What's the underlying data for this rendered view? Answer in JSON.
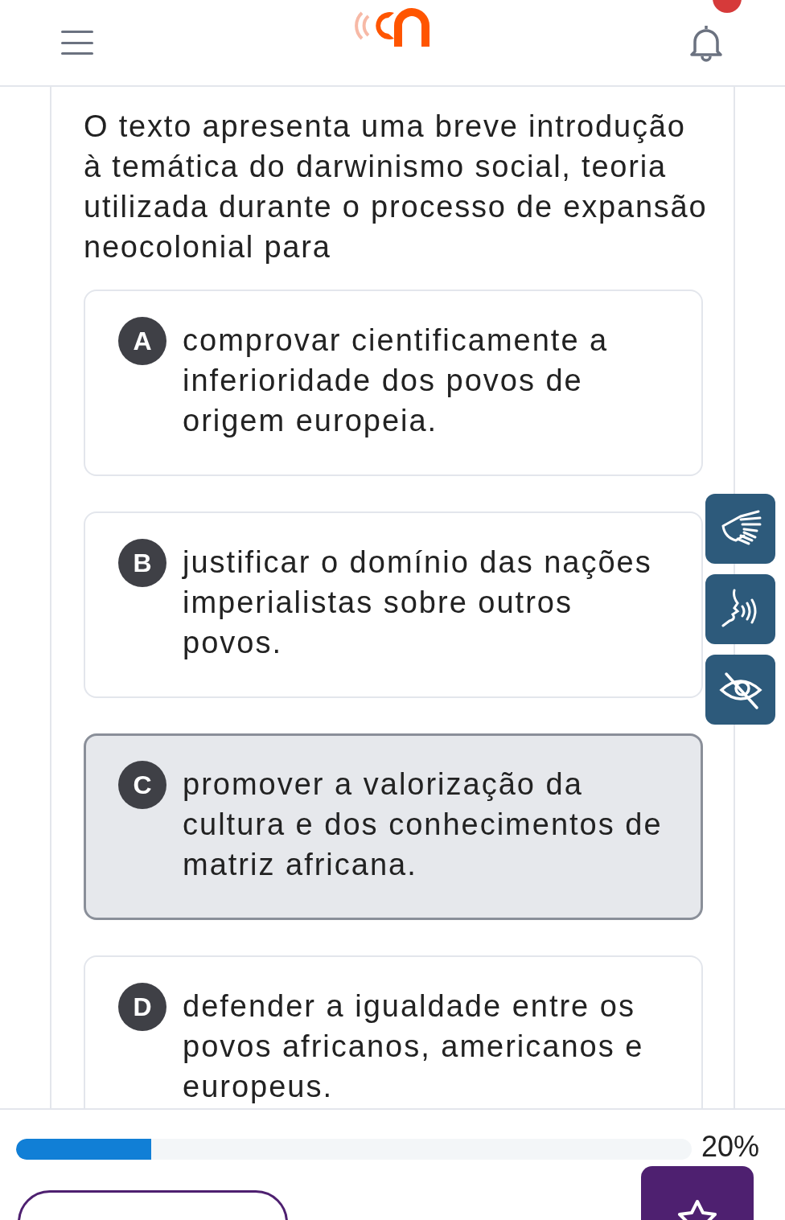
{
  "question": {
    "text": "O texto apresenta uma breve introdução à temática do darwinismo social, teoria utilizada durante o processo de expansão neocolonial para"
  },
  "options": [
    {
      "letter": "A",
      "text": "comprovar cientificamente a inferioridade dos povos de origem europeia.",
      "selected": false
    },
    {
      "letter": "B",
      "text": "justificar o domínio das nações imperialistas sobre outros povos.",
      "selected": false
    },
    {
      "letter": "C",
      "text": "promover a valorização da cultura e dos conhecimentos de matriz africana.",
      "selected": true
    },
    {
      "letter": "D",
      "text": "defender a igualdade entre os povos africanos, americanos e europeus.",
      "selected": false
    }
  ],
  "progress": {
    "level": 0.2,
    "reading": "20%"
  }
}
